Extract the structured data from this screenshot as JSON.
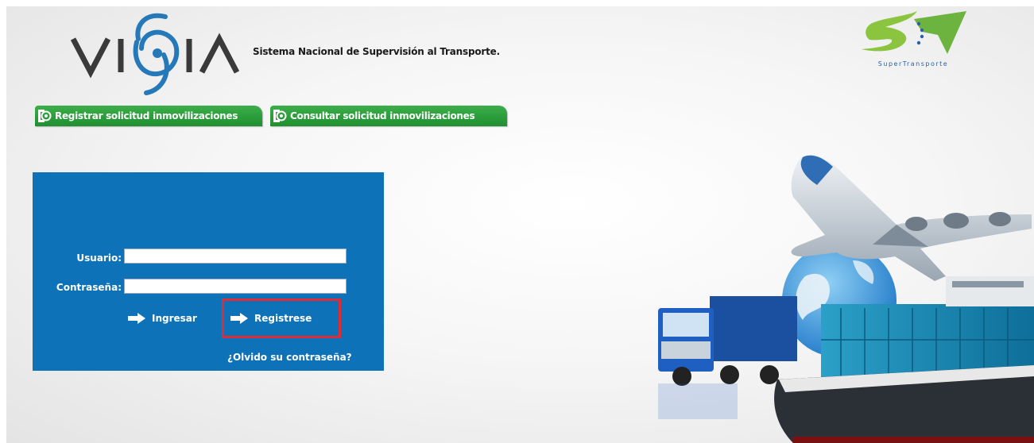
{
  "header": {
    "logo_text": "VIGIA",
    "tagline": "Sistema Nacional de Supervisión al Transporte.",
    "brand_logo_text": "SuperTransporte"
  },
  "nav": {
    "tabs": [
      {
        "label": "Registrar solicitud inmovilizaciones"
      },
      {
        "label": "Consultar solicitud inmovilizaciones"
      }
    ]
  },
  "login": {
    "user_label": "Usuario:",
    "user_value": "",
    "password_label": "Contraseña:",
    "password_value": "",
    "ingresar_label": "Ingresar",
    "registrese_label": "Registrese",
    "forgot_label": "¿Olvido su contraseña?"
  },
  "colors": {
    "panel_blue": "#0e72b9",
    "tab_green": "#2a9d3a",
    "highlight_red": "#e22c35"
  }
}
